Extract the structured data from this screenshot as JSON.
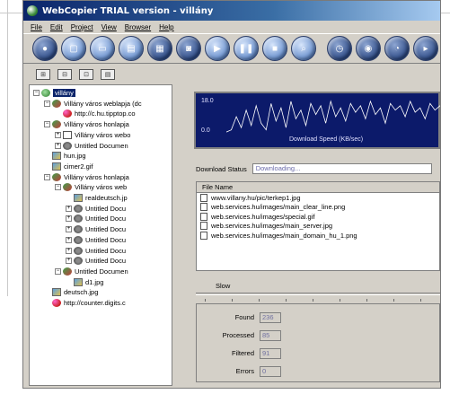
{
  "app": {
    "title": "WebCopier TRIAL version - villány"
  },
  "menu": [
    "File",
    "Edit",
    "Project",
    "View",
    "Browser",
    "Help"
  ],
  "toolbar": {
    "buttons": [
      "new-project",
      "open",
      "save",
      "close-project",
      "print",
      "settings",
      "start",
      "pause",
      "stop",
      "find",
      "scheduler",
      "update",
      "timer",
      "more"
    ]
  },
  "tree": {
    "items": [
      {
        "label": "villány",
        "level": 0,
        "icon": "globe",
        "exp": "−",
        "selected": true
      },
      {
        "label": "Villány város weblapja (dc",
        "level": 1,
        "icon": "site",
        "exp": "−"
      },
      {
        "label": "http://c.hu.tipptop.co",
        "level": 2,
        "icon": "web",
        "exp": ""
      },
      {
        "label": "Villány város honlapja",
        "level": 1,
        "icon": "site",
        "exp": "−"
      },
      {
        "label": "Villány város webo",
        "level": 2,
        "icon": "doc",
        "exp": "+"
      },
      {
        "label": "Untitled Documen",
        "level": 2,
        "icon": "gear",
        "exp": "+"
      },
      {
        "label": "hun.jpg",
        "level": 1,
        "icon": "img",
        "exp": ""
      },
      {
        "label": "cimer2.gif",
        "level": 1,
        "icon": "img",
        "exp": ""
      },
      {
        "label": "Villány város honlapja",
        "level": 1,
        "icon": "site",
        "exp": "−"
      },
      {
        "label": "Villány város web",
        "level": 2,
        "icon": "site",
        "exp": "−"
      },
      {
        "label": "realdeutsch.jp",
        "level": 3,
        "icon": "img",
        "exp": ""
      },
      {
        "label": "Untitled Docu",
        "level": 3,
        "icon": "gear",
        "exp": "+"
      },
      {
        "label": "Untitled Docu",
        "level": 3,
        "icon": "gear",
        "exp": "+"
      },
      {
        "label": "Untitled Docu",
        "level": 3,
        "icon": "gear",
        "exp": "+"
      },
      {
        "label": "Untitled Docu",
        "level": 3,
        "icon": "gear",
        "exp": "+"
      },
      {
        "label": "Untitled Docu",
        "level": 3,
        "icon": "gear",
        "exp": "+"
      },
      {
        "label": "Untitled Docu",
        "level": 3,
        "icon": "gear",
        "exp": "+"
      },
      {
        "label": "Untitled Documen",
        "level": 2,
        "icon": "site",
        "exp": "−"
      },
      {
        "label": "d1.jpg",
        "level": 3,
        "icon": "img",
        "exp": ""
      },
      {
        "label": "deutsch.jpg",
        "level": 1,
        "icon": "img",
        "exp": ""
      },
      {
        "label": "http://counter.digits.c",
        "level": 1,
        "icon": "web",
        "exp": ""
      }
    ]
  },
  "graph": {
    "max_label": "18.0",
    "min_label": "0.0",
    "caption": "Download Speed (KB/sec)",
    "samples": [
      2,
      3,
      9,
      4,
      12,
      5,
      14,
      6,
      3,
      15,
      7,
      13,
      4,
      16,
      8,
      12,
      5,
      15,
      10,
      14,
      6,
      16,
      9,
      13,
      7,
      15,
      11,
      14,
      8,
      16,
      10,
      13,
      6,
      15,
      12,
      14,
      9,
      16,
      11,
      13,
      8,
      15,
      12,
      14,
      10,
      16,
      9,
      15
    ]
  },
  "download": {
    "status_label": "Download Status",
    "status_value": "Downloading..."
  },
  "files": {
    "header": "File Name",
    "rows": [
      "www.villany.hu/pic/terkep1.jpg",
      "web.services.hu/images/main_clear_line.png",
      "web.services.hu/images/special.gif",
      "web.services.hu/images/main_server.jpg",
      "web.services.hu/images/main_domain_hu_1.png"
    ]
  },
  "speed": {
    "label": "Slow"
  },
  "stats": [
    {
      "label": "Found",
      "value": "236"
    },
    {
      "label": "Processed",
      "value": "85"
    },
    {
      "label": "Filtered",
      "value": "91"
    },
    {
      "label": "Errors",
      "value": "0"
    }
  ]
}
